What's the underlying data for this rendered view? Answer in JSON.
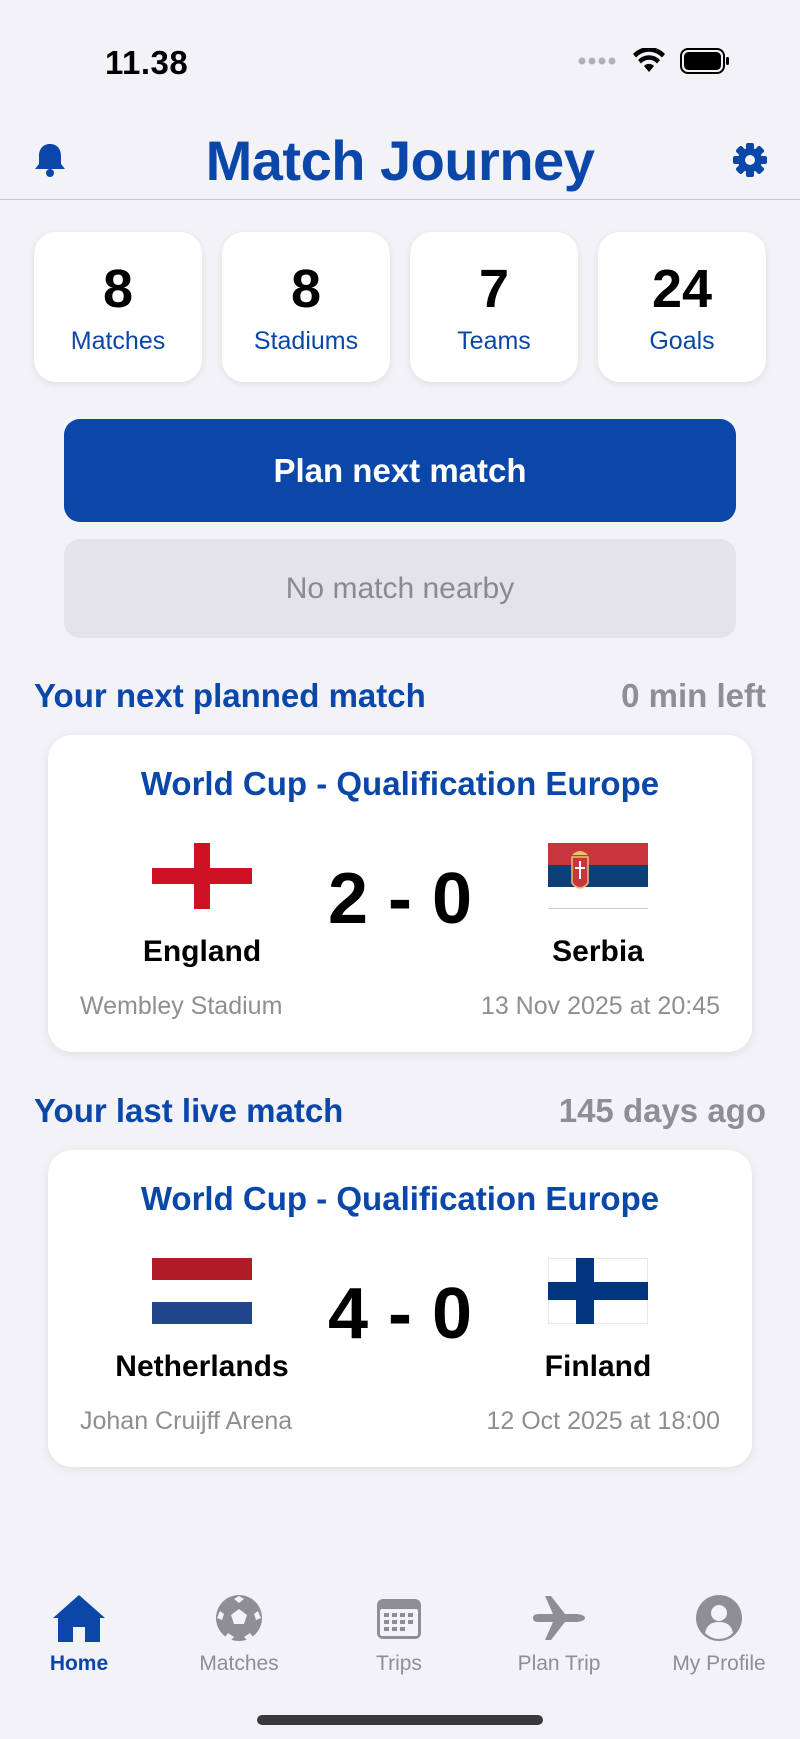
{
  "status_bar": {
    "time": "11.38"
  },
  "header": {
    "title": "Match Journey",
    "left_icon": "bell-icon",
    "right_icon": "gear-icon"
  },
  "stats": [
    {
      "value": "8",
      "label": "Matches"
    },
    {
      "value": "8",
      "label": "Stadiums"
    },
    {
      "value": "7",
      "label": "Teams"
    },
    {
      "value": "24",
      "label": "Goals"
    }
  ],
  "actions": {
    "plan_next": "Plan next match",
    "no_match_nearby": "No match nearby"
  },
  "next_match": {
    "section_title": "Your next planned match",
    "time_left": "0 min left",
    "competition": "World Cup - Qualification Europe",
    "home_team": "England",
    "away_team": "Serbia",
    "score": "2 - 0",
    "venue": "Wembley Stadium",
    "date": "13 Nov 2025 at 20:45"
  },
  "last_match": {
    "section_title": "Your last live match",
    "ago": "145 days ago",
    "competition": "World Cup - Qualification Europe",
    "home_team": "Netherlands",
    "away_team": "Finland",
    "score": "4 - 0",
    "venue": "Johan Cruijff Arena",
    "date": "12 Oct 2025 at 18:00"
  },
  "tabs": [
    {
      "label": "Home",
      "icon": "home-icon",
      "active": true
    },
    {
      "label": "Matches",
      "icon": "soccer-ball-icon",
      "active": false
    },
    {
      "label": "Trips",
      "icon": "calendar-icon",
      "active": false
    },
    {
      "label": "Plan Trip",
      "icon": "airplane-icon",
      "active": false
    },
    {
      "label": "My Profile",
      "icon": "profile-icon",
      "active": false
    }
  ],
  "colors": {
    "accent": "#0a47a9",
    "background": "#f2f2f7",
    "muted": "#8e8e93"
  }
}
